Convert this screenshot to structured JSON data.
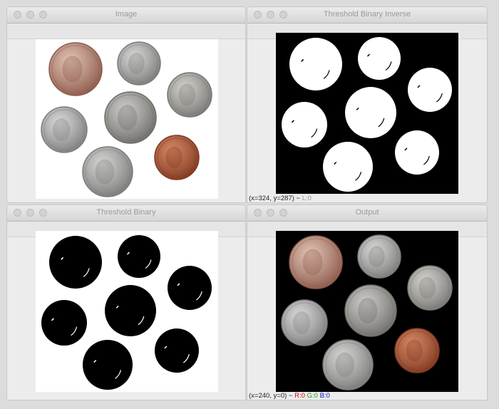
{
  "windows": {
    "image": {
      "title": "Image"
    },
    "inverse": {
      "title": "Threshold Binary Inverse",
      "status": {
        "coords": "(x=324, y=287) ~",
        "value": "L:0"
      }
    },
    "binary": {
      "title": "Threshold Binary"
    },
    "output": {
      "title": "Output",
      "status": {
        "coords": "(x=240, y=0) ~",
        "r": "R:0",
        "g": "G:0",
        "b": "B:0"
      }
    }
  },
  "colors": {
    "desktop": "#dcdcdc",
    "window_bg": "#ececec",
    "title_text": "#9a9a9a",
    "red_channel": "#d80000",
    "green_channel": "#1a9a1a",
    "blue_channel": "#1010c8"
  },
  "icons": {
    "close": "close-light-icon",
    "minimize": "minimize-light-icon",
    "zoom": "zoom-light-icon"
  }
}
